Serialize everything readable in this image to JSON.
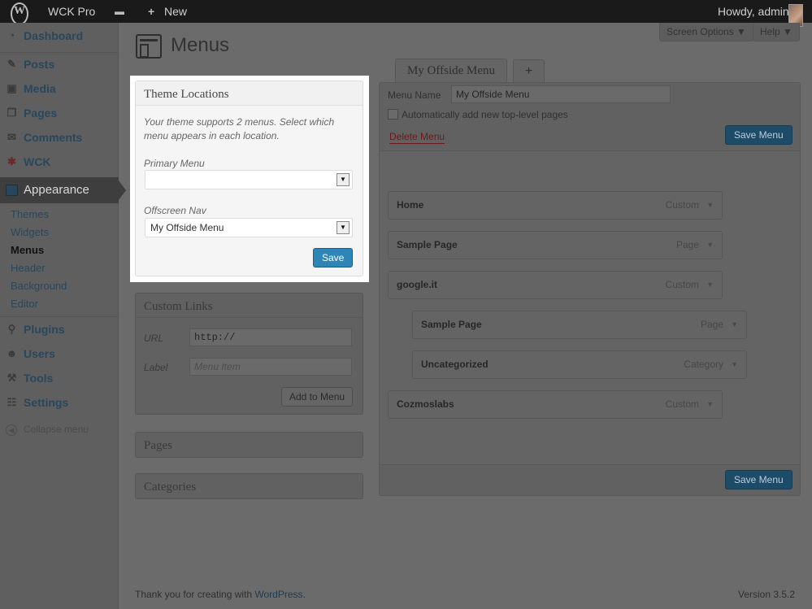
{
  "adminbar": {
    "site_name": "WCK Pro",
    "new_label": "New",
    "greeting": "Howdy, admin",
    "plus": "+",
    "comment_glyph": "▬"
  },
  "sidebar": {
    "items_top": [
      {
        "label": "Dashboard",
        "icon": "dashboard-icon"
      },
      {
        "label": "Posts",
        "icon": "pin-icon"
      },
      {
        "label": "Media",
        "icon": "media-icon"
      },
      {
        "label": "Pages",
        "icon": "pages-icon"
      },
      {
        "label": "Comments",
        "icon": "comments-icon"
      },
      {
        "label": "WCK",
        "icon": "wck-icon"
      }
    ],
    "active": "Appearance",
    "submenu": [
      "Themes",
      "Widgets",
      "Menus",
      "Header",
      "Background",
      "Editor"
    ],
    "items_bottom": [
      {
        "label": "Plugins",
        "icon": "plugin-icon"
      },
      {
        "label": "Users",
        "icon": "users-icon"
      },
      {
        "label": "Tools",
        "icon": "tools-icon"
      },
      {
        "label": "Settings",
        "icon": "settings-icon"
      }
    ],
    "collapse": "Collapse menu"
  },
  "top_tabs": {
    "screen_options": "Screen Options ▼",
    "help": "Help ▼"
  },
  "page_title": "Menus",
  "theme_locations": {
    "title": "Theme Locations",
    "help": "Your theme supports 2 menus. Select which menu appears in each location.",
    "primary_label": "Primary Menu",
    "primary_value": "",
    "offscreen_label": "Offscreen Nav",
    "offscreen_value": "My Offside Menu",
    "save": "Save"
  },
  "custom_links": {
    "title": "Custom Links",
    "url_label": "URL",
    "url_value": "http://",
    "label_label": "Label",
    "label_placeholder": "Menu Item",
    "add_button": "Add to Menu"
  },
  "pages_panel": "Pages",
  "categories_panel": "Categories",
  "menu_tabs": {
    "active": "My Offside Menu",
    "add": "+"
  },
  "menu_edit": {
    "name_label": "Menu Name",
    "name_value": "My Offside Menu",
    "auto_add": "Automatically add new top-level pages",
    "delete": "Delete Menu",
    "save": "Save Menu",
    "items": [
      {
        "title": "Home",
        "type": "Custom",
        "depth": 0
      },
      {
        "title": "Sample Page",
        "type": "Page",
        "depth": 0
      },
      {
        "title": "google.it",
        "type": "Custom",
        "depth": 0
      },
      {
        "title": "Sample Page",
        "type": "Page",
        "depth": 1
      },
      {
        "title": "Uncategorized",
        "type": "Category",
        "depth": 1
      },
      {
        "title": "Cozmoslabs",
        "type": "Custom",
        "depth": 0
      }
    ]
  },
  "footer": {
    "thanks": "Thank you for creating with ",
    "link": "WordPress",
    "period": ".",
    "version": "Version 3.5.2"
  },
  "arrow_glyph": "▼",
  "colors": {
    "overlay_gray": "#6b6b6b",
    "save_blue": "#2e86b7",
    "adminbar": "#1a1a1a"
  }
}
